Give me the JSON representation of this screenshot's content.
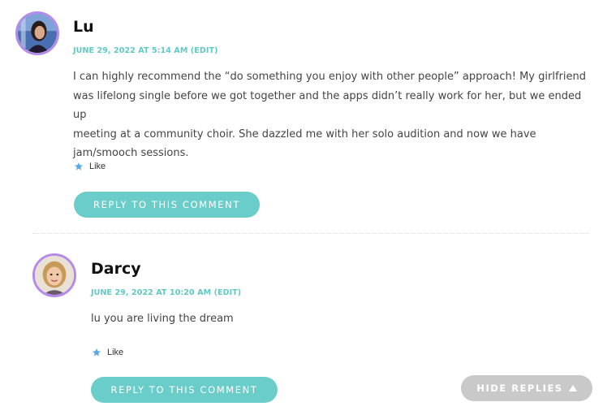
{
  "comments": [
    {
      "author": "Lu",
      "date": "JUNE 29, 2022 AT 5:14 AM",
      "edit_label": "(EDIT)",
      "body_lines": [
        "I can highly recommend the “do something you enjoy with other people” approach! My girlfriend",
        "was lifelong single before we got together and the apps didn’t really work for her, but we ended up",
        "meeting at a community choir. She dazzled me with her solo audition and now we have",
        "jam/smooch sessions."
      ],
      "like_label": "Like",
      "reply_label": "REPLY TO THIS COMMENT"
    },
    {
      "author": "Darcy",
      "date": "JUNE 29, 2022 AT 10:20 AM",
      "edit_label": "(EDIT)",
      "body_lines": [
        "lu you are living the dream"
      ],
      "like_label": "Like",
      "reply_label": "REPLY TO THIS COMMENT"
    }
  ],
  "hide_replies_label": "HIDE REPLIES",
  "colors": {
    "accent": "#5fc9c4",
    "button": "#6bcdc9",
    "avatar_ring": "#b48be8",
    "like_star": "#5aa9e6",
    "hide_button": "#c9c9c9"
  },
  "icons": {
    "like": "star-icon",
    "hide": "triangle-up-icon"
  }
}
